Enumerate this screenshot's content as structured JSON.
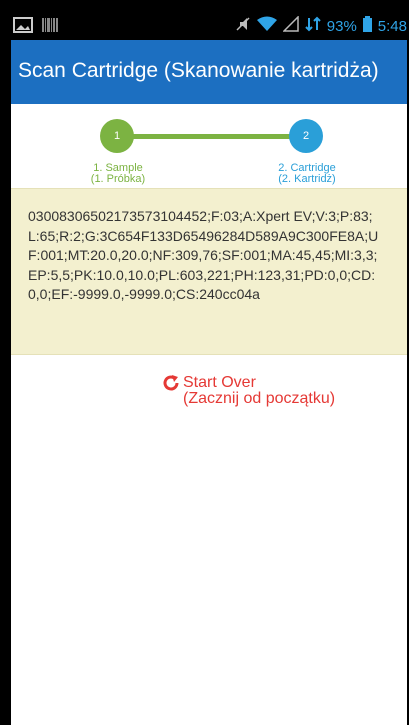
{
  "status": {
    "battery_percent": "93%",
    "time": "5:48",
    "icons": [
      "image-icon",
      "barcode-icon",
      "mute-icon",
      "wifi-icon",
      "signal-icon",
      "data-icon",
      "battery-icon"
    ]
  },
  "appbar": {
    "title": "Scan Cartridge (Skanowanie kartridża)"
  },
  "stepper": {
    "steps": [
      {
        "number": "1",
        "label_line1": "1. Sample",
        "label_line2": "(1. Próbka)",
        "color": "#7cb342"
      },
      {
        "number": "2",
        "label_line1": "2. Cartridge",
        "label_line2": "(2. Kartridż)",
        "color": "#2a9fd8"
      }
    ]
  },
  "scan_data": "03008306502173573104452;F:03;A:Xpert EV;V:3;P:83;L:65;R:2;G:3C654F133D65496284D589A9C300FE8A;UF:001;MT:20.0,20.0;NF:309,76;SF:001;MA:45,45;MI:3,3;EP:5,5;PK:10.0,10.0;PL:603,221;PH:123,31;PD:0,0;CD:0,0;EF:-9999.0,-9999.0;CS:240cc04a",
  "actions": {
    "start_over_line1": "Start Over",
    "start_over_line2": "(Zacznij od początku)",
    "accent": "#e53935"
  }
}
